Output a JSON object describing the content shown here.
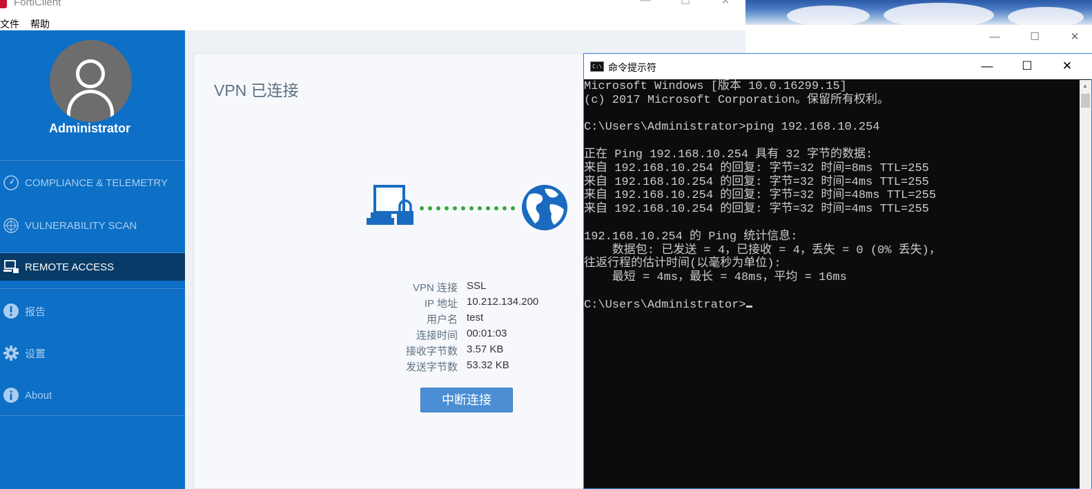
{
  "forticlient": {
    "title": "FortiClient",
    "menu": [
      "文件",
      "帮助"
    ],
    "user": "Administrator",
    "nav": [
      {
        "label": "COMPLIANCE & TELEMETRY",
        "icon": "speedometer-icon"
      },
      {
        "label": "VULNERABILITY SCAN",
        "icon": "radar-icon"
      },
      {
        "label": "REMOTE ACCESS",
        "icon": "remote-access-icon",
        "active": true
      },
      {
        "label": "报告",
        "icon": "alert-icon"
      },
      {
        "label": "设置",
        "icon": "gear-icon"
      },
      {
        "label": "About",
        "icon": "info-icon"
      }
    ],
    "vpn": {
      "status_title": "VPN 已连接",
      "fields": [
        {
          "key": "VPN 连接",
          "value": "SSL"
        },
        {
          "key": "IP 地址",
          "value": "10.212.134.200"
        },
        {
          "key": "用户名",
          "value": "test"
        },
        {
          "key": "连接时间",
          "value": "00:01:03"
        },
        {
          "key": "接收字节数",
          "value": "3.57 KB"
        },
        {
          "key": "发送字节数",
          "value": "53.32 KB"
        }
      ],
      "disconnect_label": "中断连接"
    },
    "accent_color": "#0d6fc5"
  },
  "cmd": {
    "title": "命令提示符",
    "icon_text": "C:\\",
    "lines": [
      "Microsoft Windows [版本 10.0.16299.15]",
      "(c) 2017 Microsoft Corporation。保留所有权利。",
      "",
      "C:\\Users\\Administrator>ping 192.168.10.254",
      "",
      "正在 Ping 192.168.10.254 具有 32 字节的数据:",
      "来自 192.168.10.254 的回复: 字节=32 时间=8ms TTL=255",
      "来自 192.168.10.254 的回复: 字节=32 时间=4ms TTL=255",
      "来自 192.168.10.254 的回复: 字节=32 时间=48ms TTL=255",
      "来自 192.168.10.254 的回复: 字节=32 时间=4ms TTL=255",
      "",
      "192.168.10.254 的 Ping 统计信息:",
      "    数据包: 已发送 = 4，已接收 = 4，丢失 = 0 (0% 丢失)，",
      "往返行程的估计时间(以毫秒为单位):",
      "    最短 = 4ms，最长 = 48ms，平均 = 16ms",
      "",
      "C:\\Users\\Administrator>"
    ]
  },
  "window_controls": {
    "minimize": "—",
    "maximize": "☐",
    "close": "✕"
  }
}
